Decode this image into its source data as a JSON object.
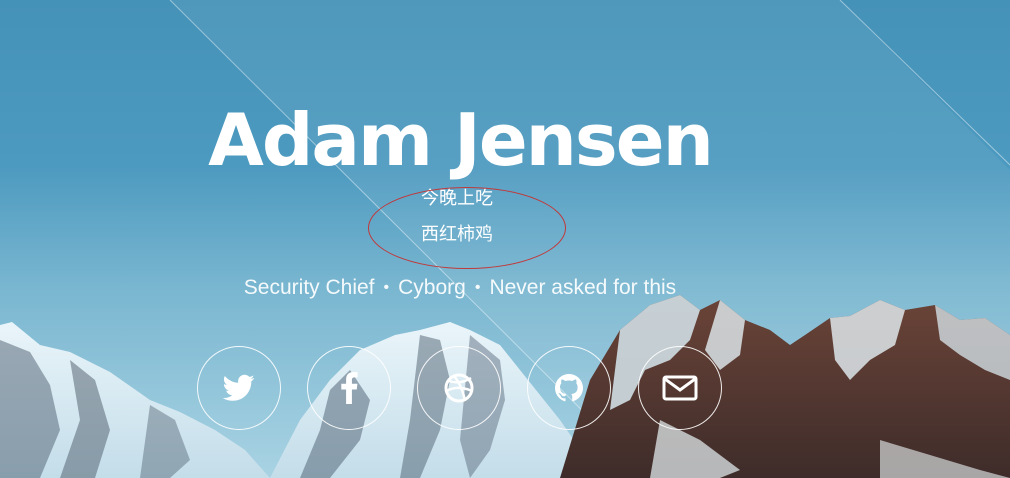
{
  "profile": {
    "name": "Adam Jensen",
    "tagline": [
      "Security Chief",
      "Cyborg",
      "Never asked for this"
    ],
    "separator": "•"
  },
  "annotation": {
    "lines": [
      "今晚上吃",
      "西红柿鸡"
    ],
    "circle_color": "#c0393b"
  },
  "social_links": [
    {
      "icon": "twitter-icon"
    },
    {
      "icon": "facebook-icon"
    },
    {
      "icon": "dribbble-icon"
    },
    {
      "icon": "github-icon"
    },
    {
      "icon": "email-icon"
    }
  ],
  "colors": {
    "sky": "#4592b8",
    "text": "#ffffff"
  }
}
